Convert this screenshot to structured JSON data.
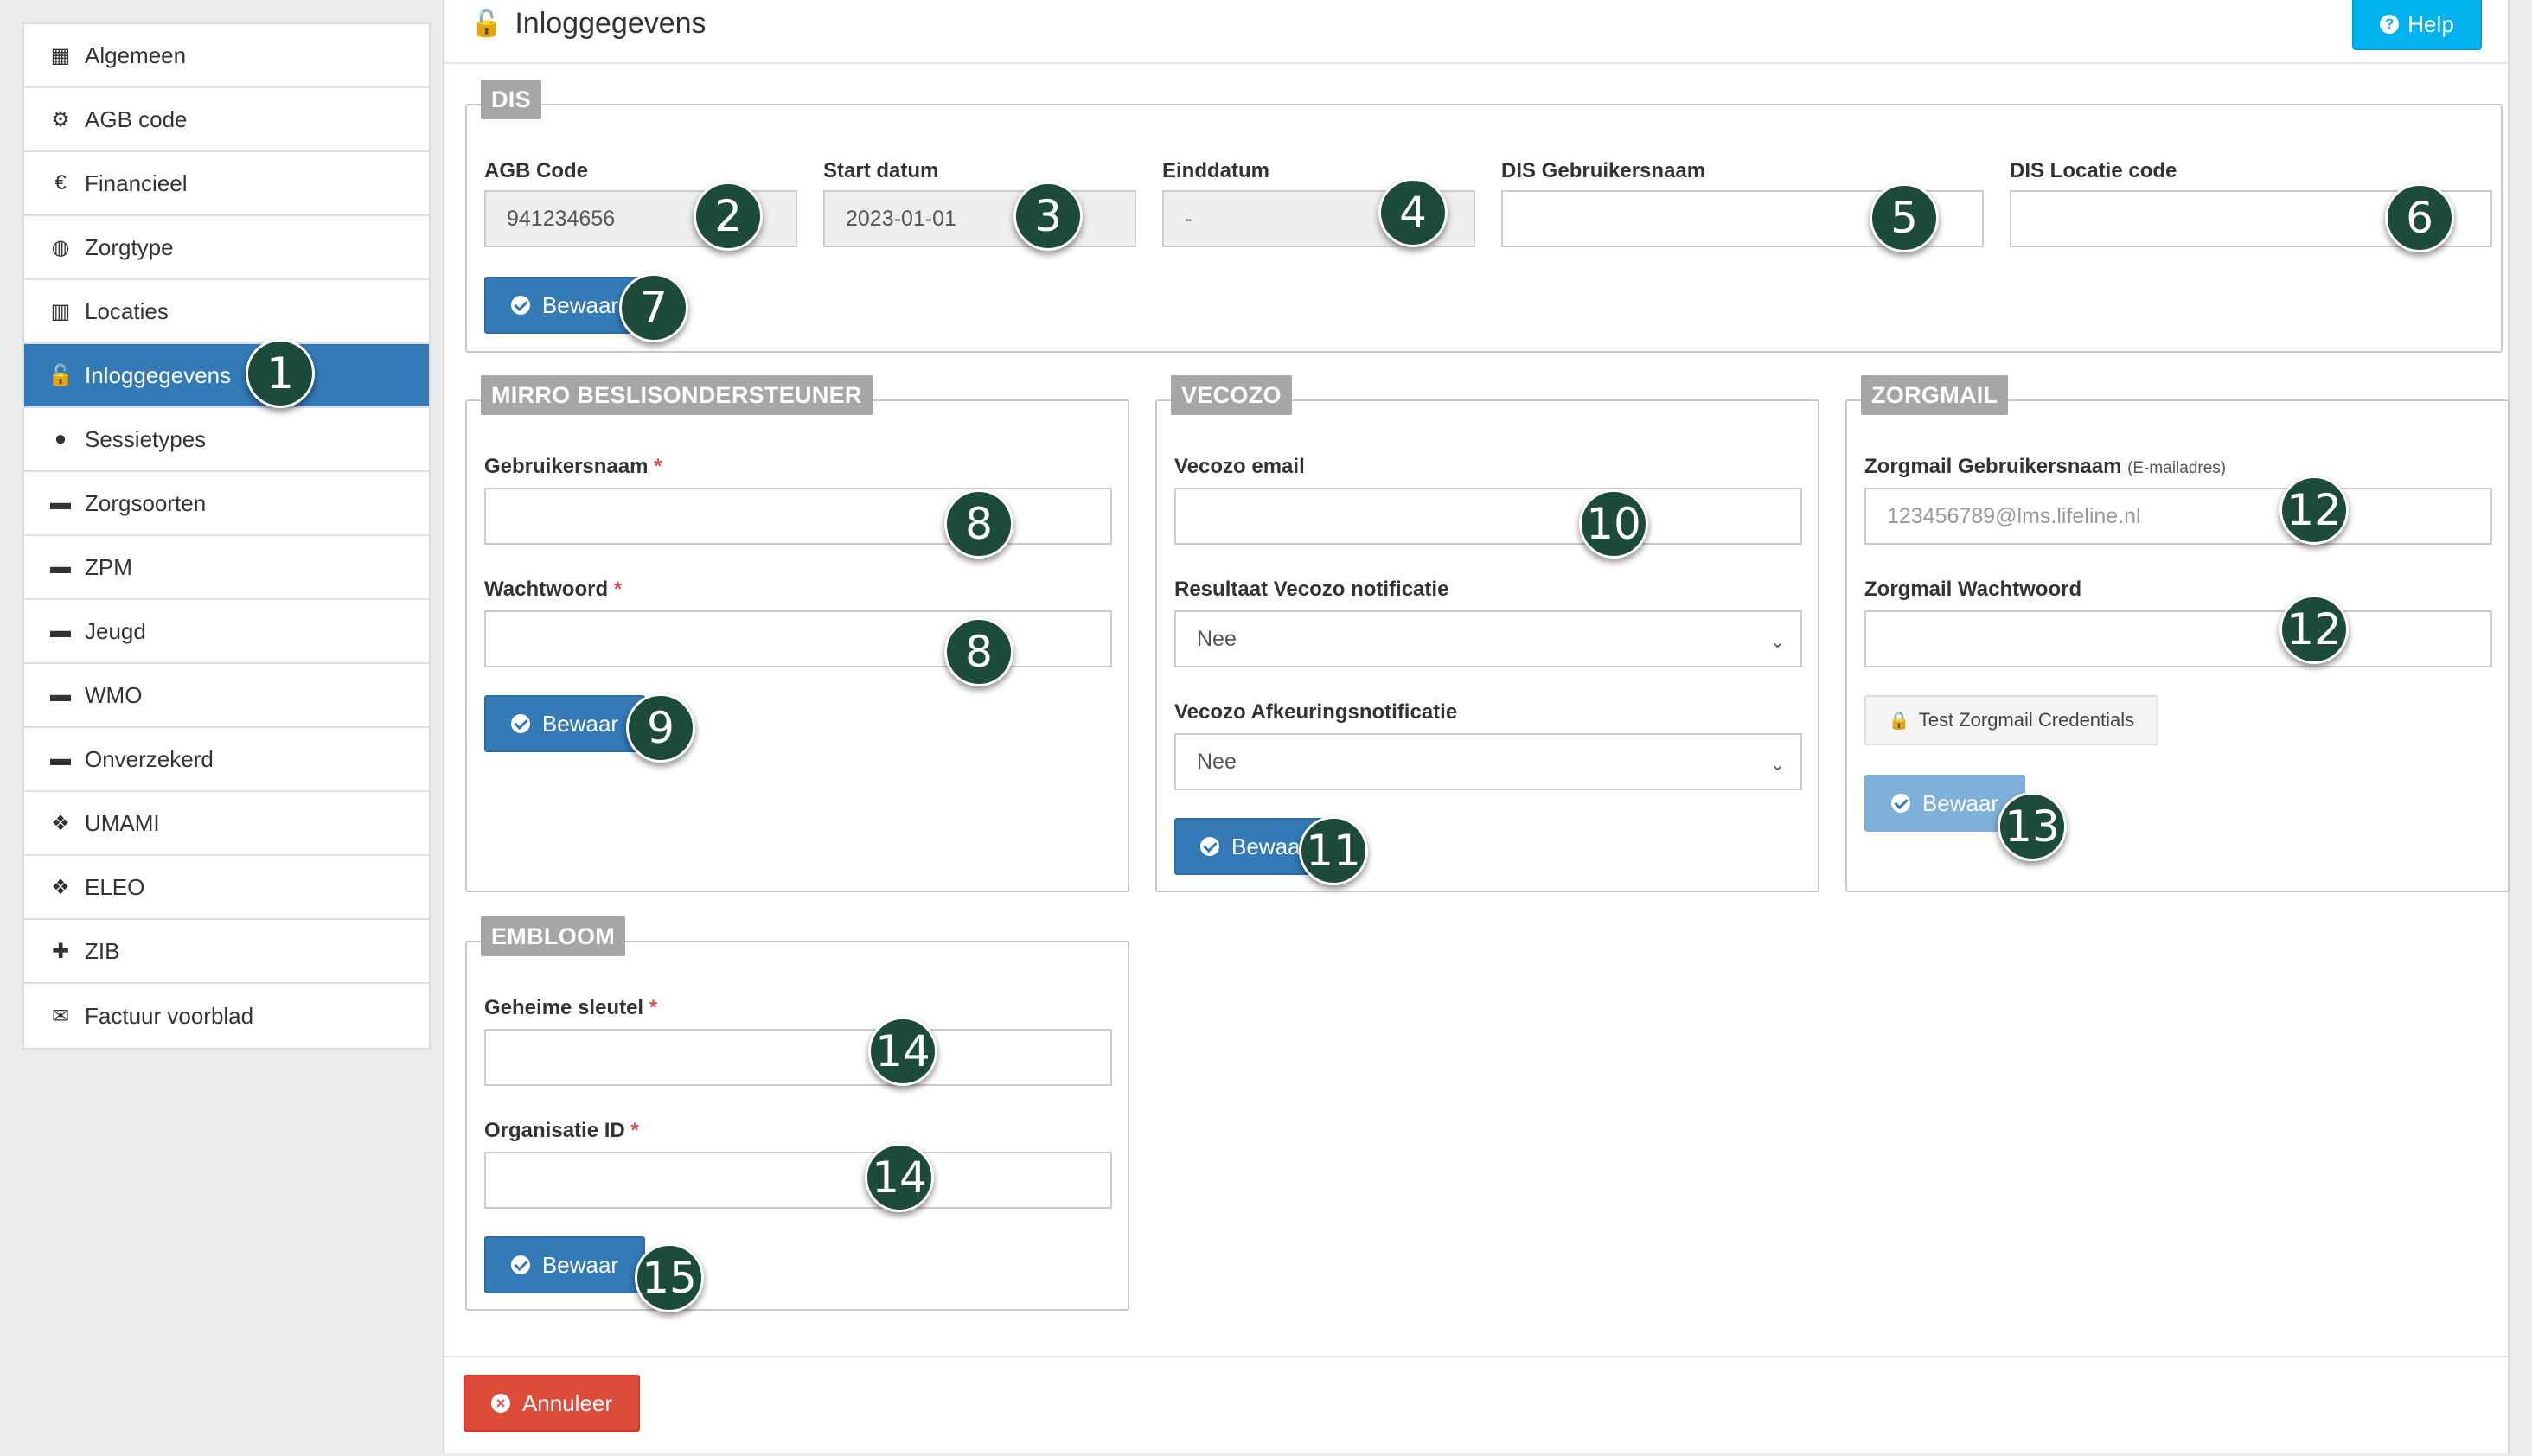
{
  "sidebar": {
    "items": [
      {
        "label": "Algemeen",
        "icon": "table-icon",
        "glyph": "▦"
      },
      {
        "label": "AGB code",
        "icon": "gears-icon",
        "glyph": "⚙"
      },
      {
        "label": "Financieel",
        "icon": "euro-icon",
        "glyph": "€"
      },
      {
        "label": "Zorgtype",
        "icon": "life-ring-icon",
        "glyph": "◍"
      },
      {
        "label": "Locaties",
        "icon": "map-icon",
        "glyph": "▥"
      },
      {
        "label": "Inloggegevens",
        "icon": "unlock-icon",
        "glyph": "🔓",
        "active": true
      },
      {
        "label": "Sessietypes",
        "icon": "globe-icon",
        "glyph": "●"
      },
      {
        "label": "Zorgsoorten",
        "icon": "briefcase-icon",
        "glyph": "▬"
      },
      {
        "label": "ZPM",
        "icon": "briefcase-icon",
        "glyph": "▬"
      },
      {
        "label": "Jeugd",
        "icon": "briefcase-icon",
        "glyph": "▬"
      },
      {
        "label": "WMO",
        "icon": "briefcase-icon",
        "glyph": "▬"
      },
      {
        "label": "Onverzekerd",
        "icon": "briefcase-icon",
        "glyph": "▬"
      },
      {
        "label": "UMAMI",
        "icon": "cubes-icon",
        "glyph": "❖"
      },
      {
        "label": "ELEO",
        "icon": "cubes-icon",
        "glyph": "❖"
      },
      {
        "label": "ZIB",
        "icon": "puzzle-icon",
        "glyph": "✚"
      },
      {
        "label": "Factuur voorblad",
        "icon": "envelope-icon",
        "glyph": "✉"
      }
    ]
  },
  "header": {
    "title": "Inloggegevens",
    "help_label": "Help"
  },
  "dis": {
    "legend": "DIS",
    "agb_label": "AGB Code",
    "agb_value": "941234656",
    "start_label": "Start datum",
    "start_value": "2023-01-01",
    "end_label": "Einddatum",
    "end_value": "-",
    "user_label": "DIS Gebruikersnaam",
    "user_value": "",
    "loc_label": "DIS Locatie code",
    "loc_value": "",
    "save_label": "Bewaar"
  },
  "mirro": {
    "legend": "MIRRO BESLISONDERSTEUNER",
    "user_label": "Gebruikersnaam",
    "pass_label": "Wachtwoord",
    "required": "*",
    "save_label": "Bewaar"
  },
  "vecozo": {
    "legend": "VECOZO",
    "email_label": "Vecozo email",
    "result_label": "Resultaat Vecozo notificatie",
    "result_value": "Nee",
    "reject_label": "Vecozo Afkeuringsnotificatie",
    "reject_value": "Nee",
    "save_label": "Bewaa"
  },
  "zorgmail": {
    "legend": "ZORGMAIL",
    "user_label": "Zorgmail Gebruikersnaam",
    "user_hint": "(E-mailadres)",
    "user_placeholder": "123456789@lms.lifeline.nl",
    "pass_label": "Zorgmail Wachtwoord",
    "test_label": "Test Zorgmail Credentials",
    "save_label": "Bewaar"
  },
  "embloom": {
    "legend": "EMBLOOM",
    "secret_label": "Geheime sleutel",
    "org_label": "Organisatie ID",
    "required": "*",
    "save_label": "Bewaar"
  },
  "footer": {
    "cancel_label": "Annuleer"
  },
  "markers": [
    "1",
    "2",
    "3",
    "4",
    "5",
    "6",
    "7",
    "8",
    "8",
    "9",
    "10",
    "11",
    "12",
    "12",
    "13",
    "14",
    "14",
    "15"
  ]
}
